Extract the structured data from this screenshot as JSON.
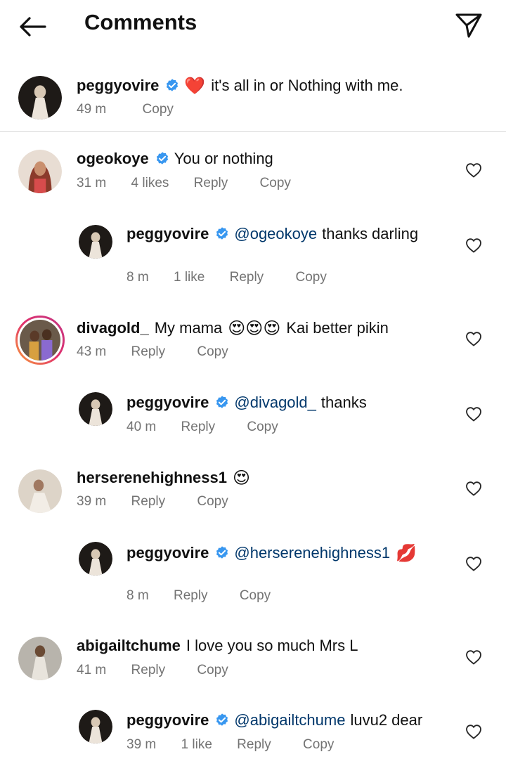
{
  "header": {
    "title": "Comments"
  },
  "caption": {
    "username": "peggyovire",
    "text": "it's all in or Nothing with me.",
    "time": "49 m",
    "copy": "Copy"
  },
  "comments": [
    {
      "username": "ogeokoye",
      "text": "You or nothing",
      "time": "31 m",
      "likes": "4 likes",
      "reply": "Reply",
      "copy": "Copy"
    },
    {
      "username": "peggyovire",
      "mention": "@ogeokoye",
      "text": "thanks darling",
      "time": "8 m",
      "likes": "1 like",
      "reply": "Reply",
      "copy": "Copy"
    },
    {
      "username": "divagold_",
      "text": "My mama",
      "text2": "Kai better pikin",
      "time": "43 m",
      "reply": "Reply",
      "copy": "Copy"
    },
    {
      "username": "peggyovire",
      "mention": "@divagold_",
      "text": "thanks",
      "time": "40 m",
      "reply": "Reply",
      "copy": "Copy"
    },
    {
      "username": "herserenehighness1",
      "text": "",
      "time": "39 m",
      "reply": "Reply",
      "copy": "Copy"
    },
    {
      "username": "peggyovire",
      "mention": "@herserenehighness1",
      "text": "",
      "time": "8 m",
      "reply": "Reply",
      "copy": "Copy"
    },
    {
      "username": "abigailtchume",
      "text": "I love you so much Mrs L",
      "time": "41 m",
      "reply": "Reply",
      "copy": "Copy"
    },
    {
      "username": "peggyovire",
      "mention": "@abigailtchume",
      "text": "luvu2 dear",
      "time": "39 m",
      "likes": "1 like",
      "reply": "Reply",
      "copy": "Copy"
    }
  ],
  "emojis": {
    "heart": "❤️",
    "heart_eyes": "😍",
    "kiss": "💋"
  },
  "colors": {
    "verified": "#3897f0",
    "mention": "#00376b",
    "meta": "#737373",
    "heart_red": "#ed4956"
  }
}
